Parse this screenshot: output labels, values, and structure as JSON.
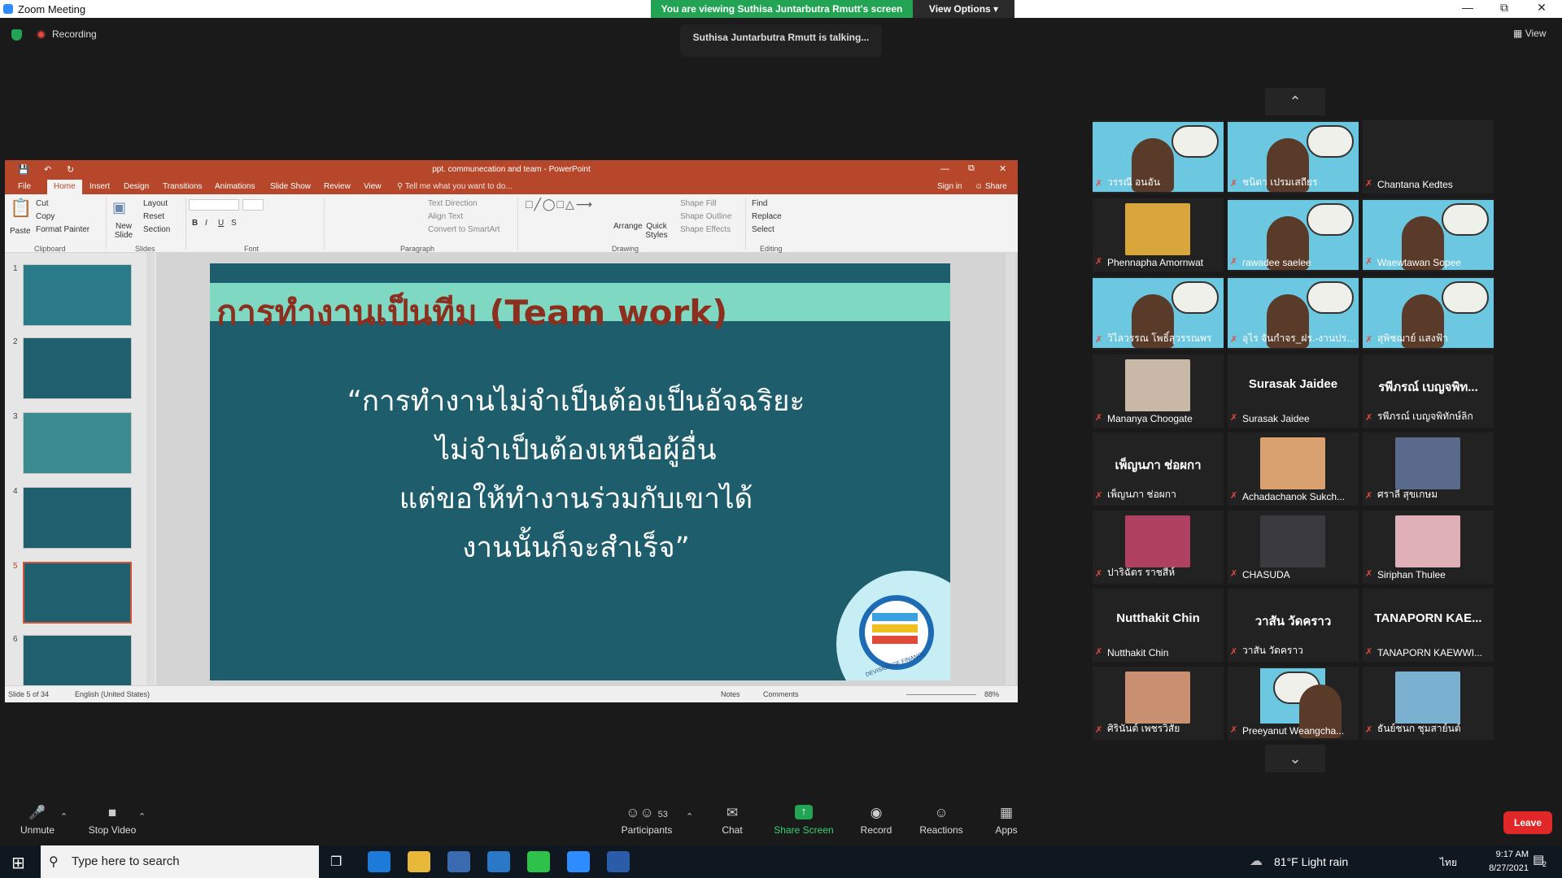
{
  "window": {
    "title": "Zoom Meeting"
  },
  "banner": {
    "viewing": "You are viewing Suthisa  Juntarbutra Rmutt's screen",
    "view_options": "View Options"
  },
  "recording": "Recording",
  "talking": "Suthisa  Juntarbutra Rmutt is talking...",
  "view_label": "View",
  "ppt": {
    "title": "ppt. communecation and team - PowerPoint",
    "tabs": [
      "File",
      "Home",
      "Insert",
      "Design",
      "Transitions",
      "Animations",
      "Slide Show",
      "Review",
      "View",
      "Tell me what you want to do..."
    ],
    "signin": "Sign in",
    "share": "Share",
    "ribbon": {
      "paste": "Paste",
      "cut": "Cut",
      "copy": "Copy",
      "format_painter": "Format Painter",
      "clipboard": "Clipboard",
      "new_slide": "New Slide",
      "layout": "Layout",
      "reset": "Reset",
      "section": "Section",
      "slides": "Slides",
      "font": "Font",
      "paragraph": "Paragraph",
      "text_direction": "Text Direction",
      "align_text": "Align Text",
      "convert": "Convert to SmartArt",
      "arrange": "Arrange",
      "quick_styles": "Quick Styles",
      "shape_fill": "Shape Fill",
      "shape_outline": "Shape Outline",
      "shape_effects": "Shape Effects",
      "drawing": "Drawing",
      "find": "Find",
      "replace": "Replace",
      "select": "Select",
      "editing": "Editing"
    },
    "thumb_numbers": [
      "1",
      "2",
      "3",
      "4",
      "5",
      "6"
    ],
    "slide": {
      "title": "การทำงานเป็นทีม (Team work)",
      "quote": [
        "“การทำงานไม่จำเป็นต้องเป็นอัจฉริยะ",
        "ไม่จำเป็นต้องเหนือผู้อื่น",
        "แต่ขอให้ทำงานร่วมกับเขาได้",
        "งานนั้นก็จะสำเร็จ”"
      ],
      "logo_text": "DEVISION OF FINANCE"
    },
    "status": {
      "slide": "Slide 5 of 34",
      "lang": "English (United States)",
      "notes": "Notes",
      "comments": "Comments",
      "zoom": "88%"
    }
  },
  "participants": [
    {
      "name": "วรรณี  อนอัน",
      "kind": "share"
    },
    {
      "name": "ชนิดา เปรมเสถียร",
      "kind": "share"
    },
    {
      "name": "Chantana Kedtes",
      "kind": "blank"
    },
    {
      "name": "Phennapha Amornwat",
      "kind": "photo",
      "color": "#d8a63a"
    },
    {
      "name": "rawadee saelee",
      "kind": "share"
    },
    {
      "name": "Waewtawan Sopee",
      "kind": "share"
    },
    {
      "name": "วิไลวรรณ โพธิ์สุวรรณพร",
      "kind": "share"
    },
    {
      "name": "อุไร จันกำจร_ฝร.-งานประ...",
      "kind": "share"
    },
    {
      "name": "สุพิชฌาย์ แสงฟ้า",
      "kind": "share"
    },
    {
      "name": "Mananya Choogate",
      "kind": "photo",
      "color": "#c9b8a8"
    },
    {
      "name": "Surasak Jaidee",
      "kind": "name",
      "big": "Surasak Jaidee"
    },
    {
      "name": "รพีภรณ์ เบญจพิทักษ์ลิก",
      "kind": "name",
      "big": "รพีภรณ์ เบญจพิท..."
    },
    {
      "name": "เพ็ญนภา ช่อผกา",
      "kind": "name",
      "big": "เพ็ญนภา ช่อผกา"
    },
    {
      "name": "Achadachanok  Sukch...",
      "kind": "photo",
      "color": "#d9a070"
    },
    {
      "name": "ศราลี  สุขเกษม",
      "kind": "photo",
      "color": "#5a6a8a"
    },
    {
      "name": "ปาริฉัตร  ราชสีห์",
      "kind": "photo",
      "color": "#b04060"
    },
    {
      "name": "CHASUDA",
      "kind": "photo",
      "color": "#3a3a40"
    },
    {
      "name": "Siriphan Thulee",
      "kind": "photo",
      "color": "#e0b0b8"
    },
    {
      "name": "Nutthakit Chin",
      "kind": "name",
      "big": "Nutthakit Chin"
    },
    {
      "name": "วาสัน วัดคราว",
      "kind": "name",
      "big": "วาสัน วัดคราว"
    },
    {
      "name": "TANAPORN KAEWWI...",
      "kind": "name",
      "big": "TANAPORN KAE..."
    },
    {
      "name": "ศิรินันต์ เพชรวิสัย",
      "kind": "photo",
      "color": "#c89070"
    },
    {
      "name": "Preeyanut Weangcha...",
      "kind": "share_small"
    },
    {
      "name": "ธันย์ชนก ชุมสาย์นต์",
      "kind": "photo",
      "color": "#7ab0d0"
    }
  ],
  "toolbar": {
    "unmute": "Unmute",
    "stop_video": "Stop Video",
    "participants": "Participants",
    "participants_count": "53",
    "chat": "Chat",
    "share_screen": "Share Screen",
    "record": "Record",
    "reactions": "Reactions",
    "apps": "Apps",
    "leave": "Leave"
  },
  "taskbar": {
    "search_placeholder": "Type here to search",
    "weather": "81°F  Light rain",
    "lang": "ไทย",
    "time": "9:17 AM",
    "date": "8/27/2021",
    "notif": "2"
  }
}
